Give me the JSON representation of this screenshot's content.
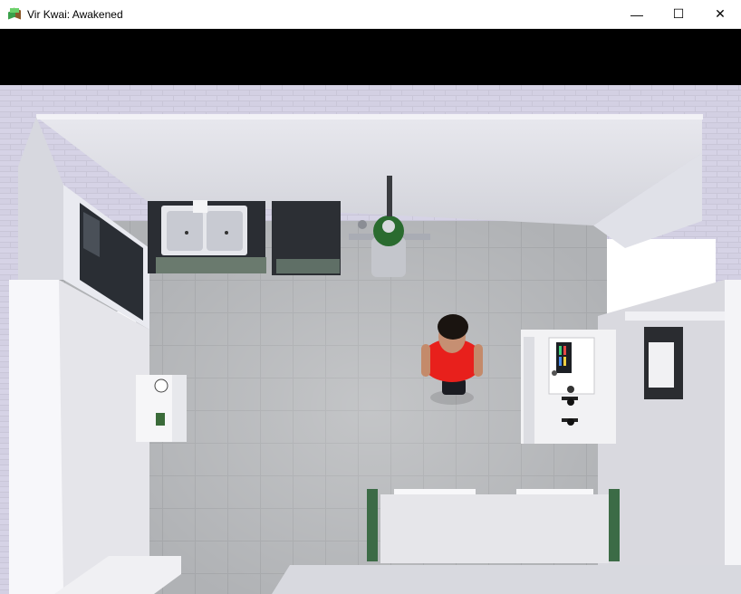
{
  "window": {
    "title": "Vir Kwai: Awakened",
    "icon": "minecraft-cube-icon",
    "controls": {
      "minimize": "—",
      "maximize": "☐",
      "close": "✕"
    }
  },
  "scene": {
    "view": "top-down",
    "room": "kitchen",
    "character": {
      "shirt_color": "#e8201c",
      "hair_color": "#1a1410"
    }
  }
}
